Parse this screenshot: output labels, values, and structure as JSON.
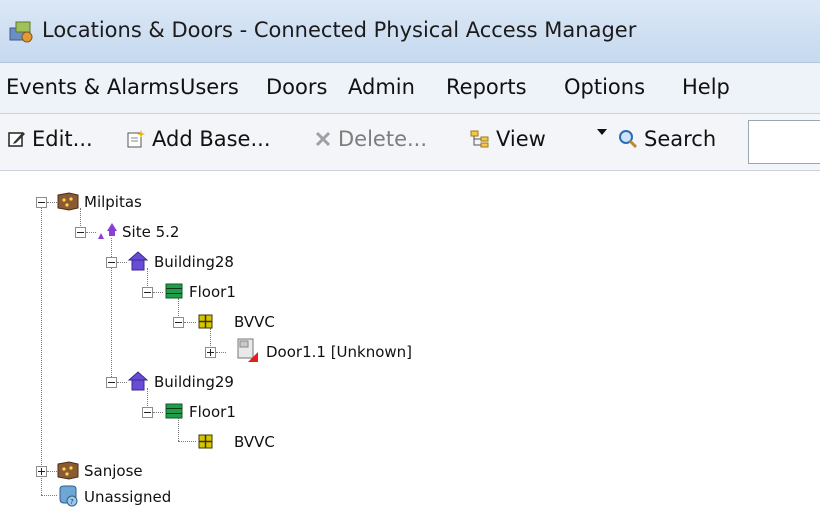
{
  "window": {
    "title": "Locations & Doors - Connected Physical Access Manager"
  },
  "menu": [
    "Events & Alarms",
    "Users",
    "Doors",
    "Admin",
    "Reports",
    "Options",
    "Help"
  ],
  "toolbar": {
    "edit": "Edit...",
    "add_base": "Add Base...",
    "delete": "Delete...",
    "view": "View",
    "search": "Search",
    "search_value": ""
  },
  "tree": {
    "milpitas": "Milpitas",
    "site": "Site 5.2",
    "building28": "Building28",
    "floor1_a": "Floor1",
    "bvvc_a": "BVVC",
    "door": "Door1.1 [Unknown]",
    "building29": "Building29",
    "floor1_b": "Floor1",
    "bvvc_b": "BVVC",
    "sanjose": "Sanjose",
    "unassigned": "Unassigned"
  }
}
